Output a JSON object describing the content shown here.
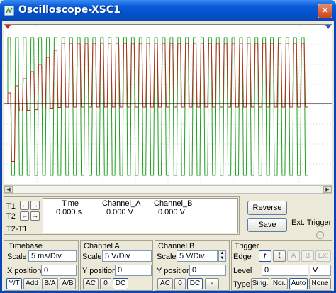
{
  "window": {
    "title": "Oscilloscope-XSC1",
    "close_glyph": "×"
  },
  "cursors": {
    "t1_label": "T1",
    "t2_label": "T2",
    "t2t1_label": "T2-T1",
    "left_glyph": "←",
    "right_glyph": "→",
    "headers": [
      "Time",
      "Channel_A",
      "Channel_B"
    ],
    "values": [
      "0.000 s",
      "0.000 V",
      "0.000 V"
    ]
  },
  "buttons": {
    "reverse": "Reverse",
    "save": "Save",
    "ext_trigger": "Ext. Trigger"
  },
  "timebase": {
    "title": "Timebase",
    "scale_label": "Scale",
    "scale_value": "5 ms/Div",
    "xpos_label": "X position",
    "xpos_value": "0",
    "modes": [
      "Y/T",
      "Add",
      "B/A",
      "A/B"
    ]
  },
  "channel_a": {
    "title": "Channel A",
    "scale_label": "Scale",
    "scale_value": "5 V/Div",
    "ypos_label": "Y position",
    "ypos_value": "0",
    "coupling": [
      "AC",
      "0",
      "DC"
    ]
  },
  "channel_b": {
    "title": "Channel B",
    "scale_label": "Scale",
    "scale_value": "5 V/Div",
    "ypos_label": "Y position",
    "ypos_value": "0",
    "coupling": [
      "AC",
      "0",
      "DC",
      "-"
    ]
  },
  "trigger": {
    "title": "Trigger",
    "edge_label": "Edge",
    "edge_rise": "ƒ",
    "edge_fall": "ƭ",
    "sources": [
      "A",
      "B",
      "Ext"
    ],
    "level_label": "Level",
    "level_value": "0",
    "level_unit": "V",
    "type_label": "Type",
    "types": [
      "Sing.",
      "Nor.",
      "Auto",
      "None"
    ]
  },
  "colors": {
    "channel_a": "#1f9e1f",
    "channel_b": "#b5301f",
    "marker": "#d02020"
  }
}
